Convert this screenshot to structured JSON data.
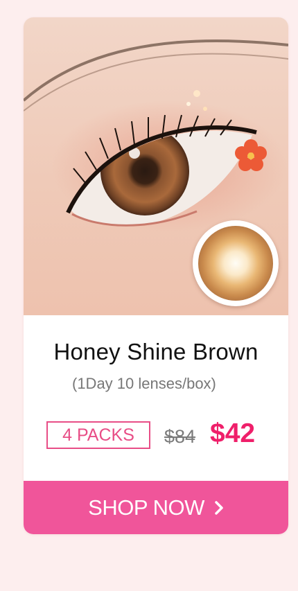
{
  "product": {
    "name": "Honey Shine Brown",
    "description": "(1Day 10 lenses/box)",
    "pack_label": "4 PACKS",
    "original_price": "$84",
    "sale_price": "$42"
  },
  "cta": {
    "label": "SHOP NOW",
    "icon": "chevron-right-icon"
  },
  "colors": {
    "page_background": "#fdeeee",
    "accent_pink": "#f0559a",
    "sale_price": "#ef1f6a",
    "pack_border": "#e84d86"
  },
  "images": {
    "hero": "eye-with-honey-brown-lens-photo",
    "lens": "honey-shine-brown-lens-thumbnail"
  }
}
